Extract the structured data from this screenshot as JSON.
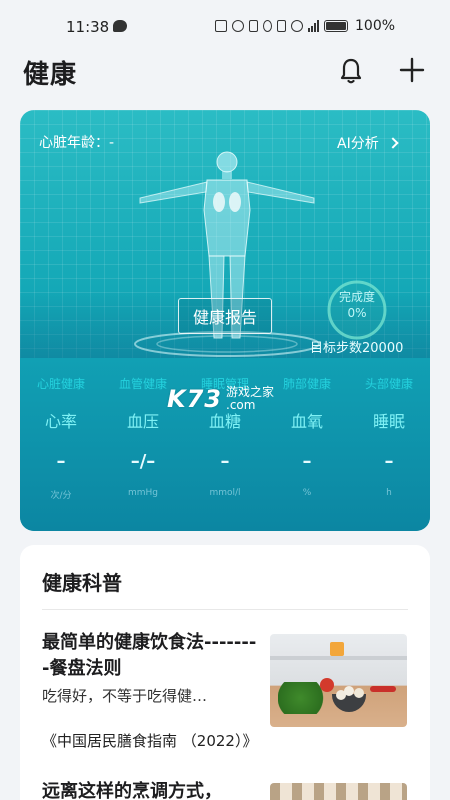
{
  "status_bar": {
    "time": "11:38",
    "battery": "100%",
    "network": "5G"
  },
  "header": {
    "title": "健康",
    "icons": [
      "bell-icon",
      "plus-icon"
    ]
  },
  "hero": {
    "heart_age_label": "心脏年龄：-",
    "ai_analysis": "AI分析",
    "report_button": "健康报告",
    "completion_label": "完成度",
    "completion_value": "0%",
    "completion_fraction": 0,
    "target_steps": "目标步数20000",
    "categories": [
      "心脏健康",
      "血管健康",
      "睡眠管理",
      "肺部健康",
      "头部健康"
    ],
    "metrics": [
      {
        "label": "心率",
        "value": "–",
        "unit": "次/分"
      },
      {
        "label": "血压",
        "value": "–/–",
        "unit": "mmHg"
      },
      {
        "label": "血糖",
        "value": "–",
        "unit": "mmol/l"
      },
      {
        "label": "血氧",
        "value": "–",
        "unit": "%"
      },
      {
        "label": "睡眠",
        "value": "–",
        "unit": "h"
      }
    ],
    "colors": {
      "accent": "#13a7b6",
      "metric_label": "#7ff1f5"
    }
  },
  "watermark": {
    "logo": "K73",
    "line1": "游戏之家",
    "line2": ".com"
  },
  "science": {
    "title": "健康科普",
    "articles": [
      {
        "title": "最简单的健康饮食法--------餐盘法则",
        "summary": "吃得好，不等于吃得健…",
        "source": "《中国居民膳食指南 （2022）》"
      },
      {
        "title": "远离这样的烹调方式，"
      }
    ]
  }
}
